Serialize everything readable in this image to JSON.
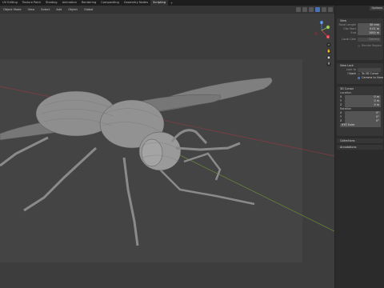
{
  "workspace_tabs": [
    "UV Editing",
    "Texture Paint",
    "Shading",
    "Animation",
    "Rendering",
    "Compositing",
    "Geometry Nodes",
    "Scripting"
  ],
  "workspace_add": "+",
  "viewport_header": {
    "mode": "Object Mode",
    "menus": [
      "View",
      "Select",
      "Add",
      "Object"
    ],
    "orientation": "Global",
    "options_label": "Options"
  },
  "gizmo": {
    "x_label": "X",
    "y_label": "Y",
    "z_label": "Z"
  },
  "npanel": {
    "tab_label": "Options",
    "view": {
      "header": "View",
      "focal_label": "Focal Length",
      "focal_value": "50 mm",
      "clip_start_label": "Clip Start",
      "clip_start_value": "0.01 m",
      "clip_end_label": "End",
      "clip_end_value": "1000 m",
      "local_cam_label": "Local Cam",
      "local_cam_value": "Camera",
      "render_region_label": "Render Region"
    },
    "view_lock": {
      "header": "View Lock",
      "lock_to_object_label": "Lock to Object",
      "lock_label": "Lock",
      "lock_3d_cursor": "To 3D Cursor",
      "lock_camera": "Camera to View"
    },
    "cursor": {
      "header": "3D Cursor",
      "location_label": "Location",
      "loc": [
        {
          "axis": "X",
          "value": "0 m"
        },
        {
          "axis": "Y",
          "value": "0 m"
        },
        {
          "axis": "Z",
          "value": "0 m"
        }
      ],
      "rotation_label": "Rotation",
      "rot": [
        {
          "axis": "X",
          "value": "0°"
        },
        {
          "axis": "Y",
          "value": "0°"
        },
        {
          "axis": "Z",
          "value": "0°"
        }
      ],
      "rotation_mode": "XYZ Euler"
    },
    "collections_header": "Collections",
    "annotations_header": "Annotations"
  },
  "colors": {
    "accent": "#4772b3",
    "x_axis": "#d83a4a",
    "y_axis": "#8bc34a",
    "z_axis": "#3d7fd9"
  }
}
